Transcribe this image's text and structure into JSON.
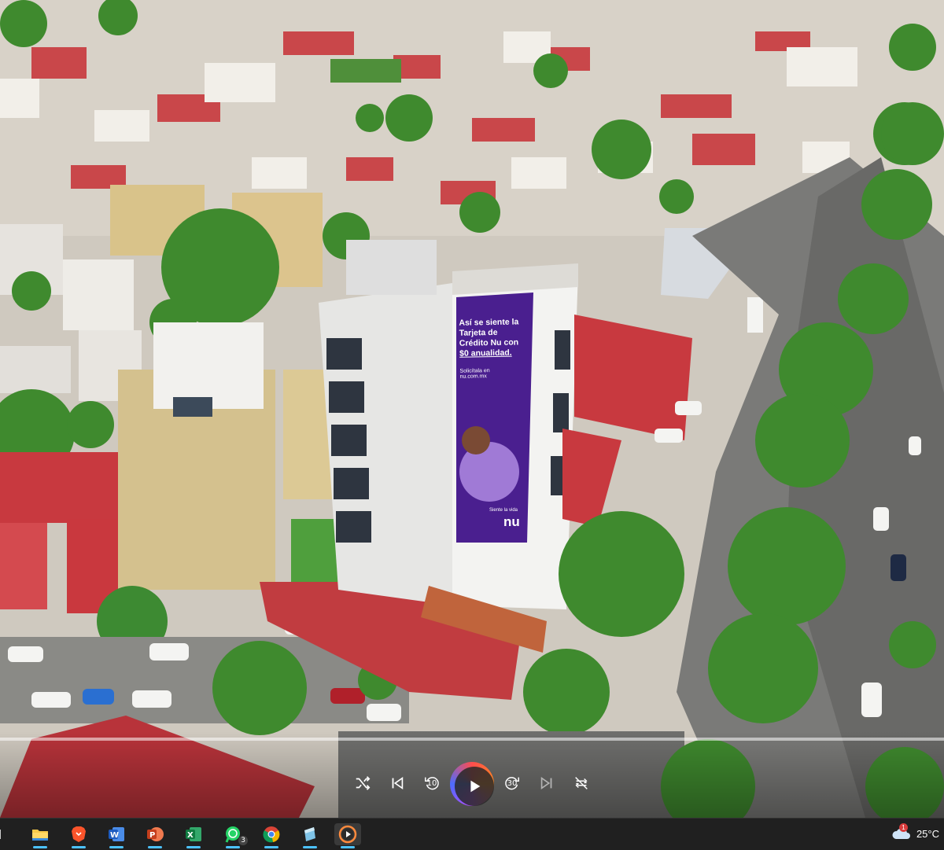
{
  "photo": {
    "billboard_text": {
      "headline_line1": "Así se siente la",
      "headline_line2": "Tarjeta de",
      "headline_line3": "Crédito Nu con",
      "headline_line4": "$0 anualidad.",
      "cta_line1": "Solicítala en",
      "cta_line2": "nu.com.mx",
      "tagline": "Siente la vida",
      "brand": "nu"
    },
    "colors": {
      "billboard": "#4a1f8f",
      "roof_red": "#c8393f",
      "tree": "#3f8a2e",
      "road": "#6c6c6c"
    }
  },
  "player": {
    "skip_back_label": "10",
    "skip_forward_label": "30",
    "progress": 0.0,
    "accent": "#ff6b3d"
  },
  "taskbar": {
    "apps": [
      {
        "icon": "file-explorer-icon"
      },
      {
        "icon": "brave-browser-icon"
      },
      {
        "icon": "word-icon"
      },
      {
        "icon": "powerpoint-icon"
      },
      {
        "icon": "excel-icon"
      },
      {
        "icon": "whatsapp-icon",
        "badge": "3"
      },
      {
        "icon": "chrome-icon"
      },
      {
        "icon": "notepad-icon"
      },
      {
        "icon": "media-player-icon"
      }
    ],
    "weather_temp": "25°C",
    "weather_alert": "1"
  }
}
